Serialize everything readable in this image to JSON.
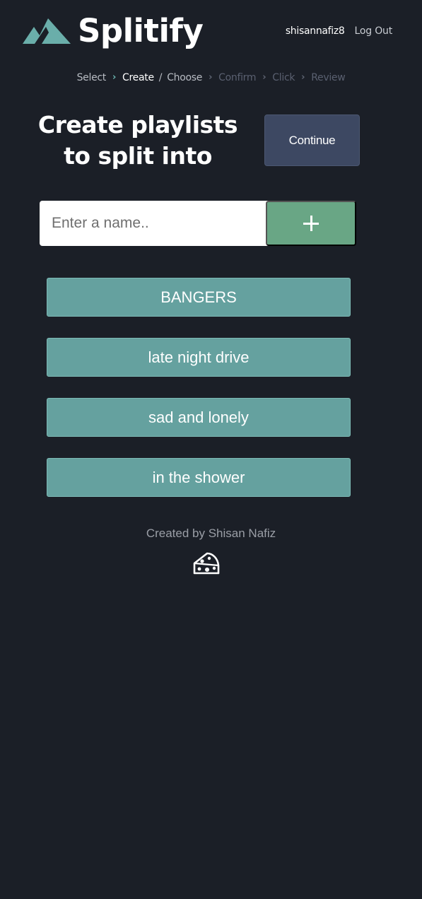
{
  "header": {
    "brand": "Splitify",
    "username": "shisannafiz8",
    "logout_label": "Log Out"
  },
  "breadcrumb": {
    "steps": [
      "Select",
      "Create",
      "/",
      "Choose",
      "Confirm",
      "Click",
      "Review"
    ],
    "active": "Create"
  },
  "main": {
    "title": "Create playlists to split into",
    "continue_label": "Continue",
    "input_placeholder": "Enter a name..",
    "input_value": "",
    "add_label": "+"
  },
  "playlists": [
    "BANGERS",
    "late night drive",
    "sad and lonely",
    "in the shower"
  ],
  "footer": {
    "credit": "Created by Shisan Nafiz"
  },
  "colors": {
    "background": "#1b1f27",
    "accent_teal": "#65a19f",
    "add_green": "#69a685",
    "continue_slate": "#3d4862"
  },
  "icons": {
    "logo": "mountain-icon",
    "add": "plus-icon",
    "footer": "cheese-icon"
  }
}
